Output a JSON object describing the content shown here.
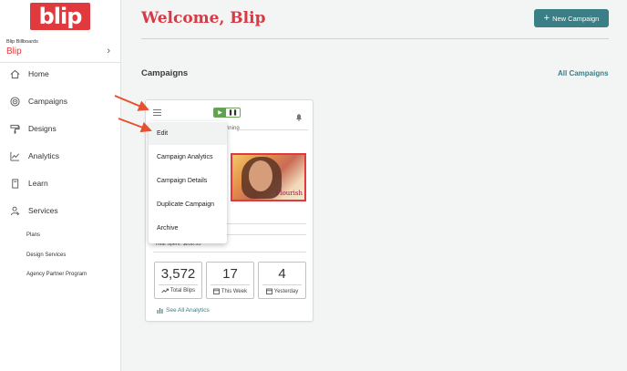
{
  "sidebar": {
    "logo_text": "blip",
    "account_label": "Blip Billboards",
    "account_name": "Blip",
    "nav": [
      {
        "label": "Home",
        "icon": "home-icon"
      },
      {
        "label": "Campaigns",
        "icon": "target-icon"
      },
      {
        "label": "Designs",
        "icon": "paint-roller-icon"
      },
      {
        "label": "Analytics",
        "icon": "chart-icon"
      },
      {
        "label": "Learn",
        "icon": "book-icon"
      },
      {
        "label": "Services",
        "icon": "user-support-icon"
      }
    ],
    "sub_items": [
      "Plans",
      "Design Services",
      "Agency Partner Program"
    ]
  },
  "header": {
    "welcome": "Welcome, Blip",
    "new_campaign": "New Campaign"
  },
  "campaigns": {
    "title": "Campaigns",
    "all_link": "All Campaigns"
  },
  "card": {
    "status_text": "nning",
    "image_brand": "Flourish",
    "spent_text": "Total Spent: $838.53",
    "stats": [
      {
        "value": "3,572",
        "label": "Total Blips",
        "icon": "trend-icon"
      },
      {
        "value": "17",
        "label": "This Week",
        "icon": "calendar-icon"
      },
      {
        "value": "4",
        "label": "Yesterday",
        "icon": "calendar-icon"
      }
    ],
    "see_all": "See All Analytics"
  },
  "menu": {
    "items": [
      "Edit",
      "Campaign Analytics",
      "Campaign Details",
      "Duplicate Campaign",
      "Archive"
    ],
    "active": "Edit"
  },
  "colors": {
    "brand_red": "#e0393e",
    "teal": "#3a7f86",
    "play_green": "#5fa24f",
    "arrow": "#e8502f"
  }
}
